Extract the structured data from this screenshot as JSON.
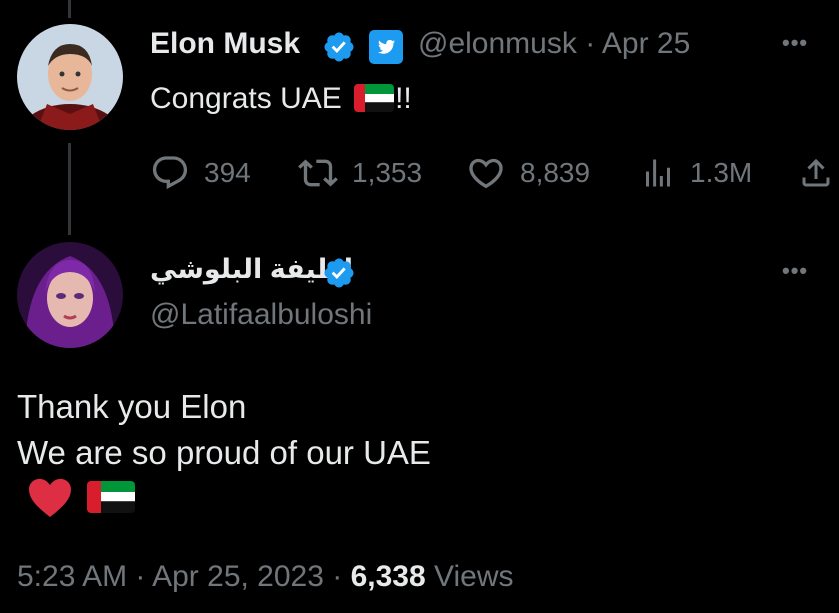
{
  "tweet": {
    "author_name": "Elon Musk",
    "handle": "@elonmusk",
    "separator": "·",
    "date": "Apr 25",
    "text": "Congrats UAE",
    "text_suffix": "!!",
    "more": "•••",
    "stats": {
      "replies": "394",
      "retweets": "1,353",
      "likes": "8,839",
      "views": "1.3M"
    }
  },
  "reply": {
    "author_name": "لطيفة البلوشي",
    "handle": "@Latifaalbuloshi",
    "more": "•••",
    "line1": "Thank you Elon",
    "line2": "We are so proud of our UAE",
    "emoji_heart": "❤️",
    "timestamp": "5:23 AM",
    "separator": "·",
    "date": "Apr 25, 2023",
    "views_count": "6,338",
    "views_label": "Views"
  },
  "colors": {
    "background": "#000000",
    "text": "#e7e9ea",
    "muted": "#71767b",
    "verified": "#1d9bf0",
    "twitter_badge": "#1d9bf0"
  },
  "icons": [
    "reply-icon",
    "retweet-icon",
    "like-icon",
    "views-icon",
    "share-icon",
    "verified-badge-icon",
    "twitter-bird-icon"
  ]
}
